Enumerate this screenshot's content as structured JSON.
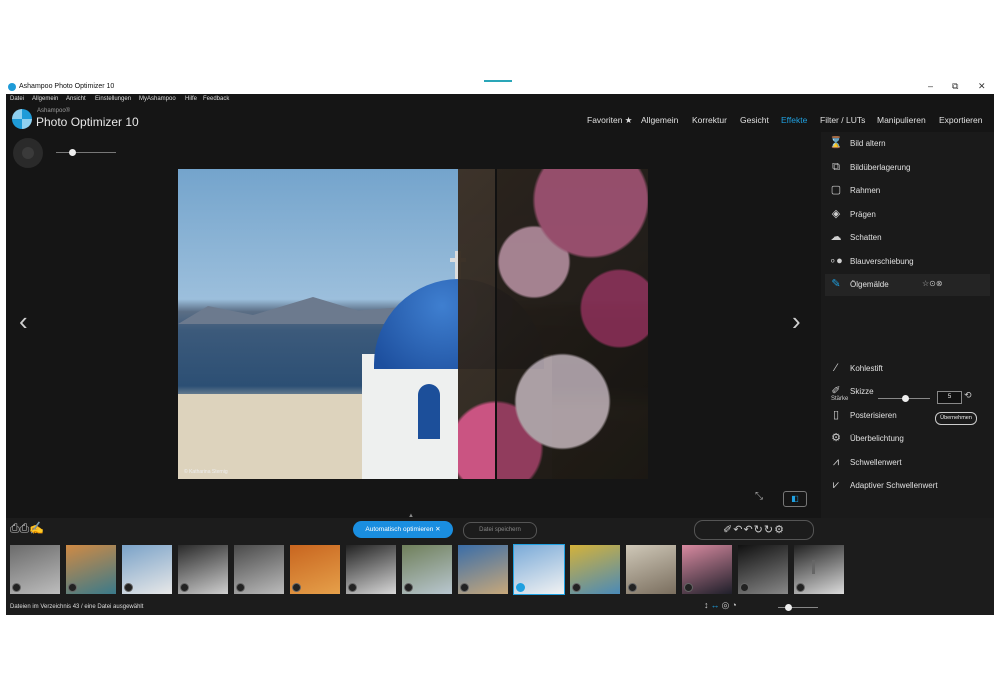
{
  "window": {
    "title": "Ashampoo Photo Optimizer 10",
    "controls": {
      "minimize": "–",
      "maximize": "⧉",
      "close": "✕"
    }
  },
  "menu": [
    "Datei",
    "Allgemein",
    "Ansicht",
    "Einstellungen",
    "MyAshampoo",
    "Hilfe",
    "Feedback"
  ],
  "brand": {
    "small": "Ashampoo®",
    "name": "Photo Optimizer 10"
  },
  "tabs": [
    {
      "label": "Favoriten ★",
      "active": false
    },
    {
      "label": "Allgemein",
      "active": false
    },
    {
      "label": "Korrektur",
      "active": false
    },
    {
      "label": "Gesicht",
      "active": false
    },
    {
      "label": "Effekte",
      "active": true
    },
    {
      "label": "Filter / LUTs",
      "active": false
    },
    {
      "label": "Manipulieren",
      "active": false
    },
    {
      "label": "Exportieren",
      "active": false
    }
  ],
  "photo": {
    "credit": "© Katharina Sternig"
  },
  "nav": {
    "prev": "‹",
    "next": "›"
  },
  "effects": [
    {
      "label": "Bild altern",
      "icon": "hourglass-icon",
      "glyph": "⌛"
    },
    {
      "label": "Bildüberlagerung",
      "icon": "layers-icon",
      "glyph": "⧉"
    },
    {
      "label": "Rahmen",
      "icon": "frame-icon",
      "glyph": "▢"
    },
    {
      "label": "Prägen",
      "icon": "emboss-icon",
      "glyph": "◈"
    },
    {
      "label": "Schatten",
      "icon": "shadow-icon",
      "glyph": "☁"
    },
    {
      "label": "Blauverschiebung",
      "icon": "blueshift-icon",
      "glyph": "∘●"
    },
    {
      "label": "Ölgemälde",
      "icon": "brush-icon",
      "glyph": "✎",
      "selected": true,
      "tools": "☆⊙⊗"
    },
    {
      "label": "Kohlestift",
      "icon": "charcoal-icon",
      "glyph": "⁄"
    },
    {
      "label": "Skizze",
      "icon": "pencil-icon",
      "glyph": "✐"
    },
    {
      "label": "Posterisieren",
      "icon": "poster-icon",
      "glyph": "▯"
    },
    {
      "label": "Überbelichtung",
      "icon": "overexpose-icon",
      "glyph": "⚙"
    },
    {
      "label": "Schwellenwert",
      "icon": "threshold-icon",
      "glyph": "⩘"
    },
    {
      "label": "Adaptiver Schwellenwert",
      "icon": "adaptive-threshold-icon",
      "glyph": "⩗"
    }
  ],
  "strength": {
    "label": "Stärke",
    "value": "5",
    "apply": "Übernehmen",
    "level": 0.5
  },
  "compare_glyph": "◧",
  "shrink_glyph": "⤡",
  "bottom": {
    "icons": "⎙⎙✍",
    "auto_optimize": "Automatisch optimieren  ✕",
    "save": "Datei speichern",
    "tools": "✐↶↶↻↻⚙"
  },
  "thumbnails": [
    {
      "name": "route-66",
      "colors": [
        "#6b6b6b",
        "#bdbdbd"
      ]
    },
    {
      "name": "horseshoe-bend",
      "colors": [
        "#d08a44",
        "#3a7a8a"
      ]
    },
    {
      "name": "waterfall-town",
      "colors": [
        "#7aa2c8",
        "#e8e8e8"
      ]
    },
    {
      "name": "flowers-bw",
      "colors": [
        "#2a2a2a",
        "#cfcfcf"
      ]
    },
    {
      "name": "rocks-bw",
      "colors": [
        "#4a4a4a",
        "#bcbcbc"
      ]
    },
    {
      "name": "monument-valley",
      "colors": [
        "#c8651f",
        "#e6a04a"
      ]
    },
    {
      "name": "street-carriage",
      "colors": [
        "#222",
        "#d8d8d8"
      ]
    },
    {
      "name": "river-road",
      "colors": [
        "#6f7f5a",
        "#b9c7d0"
      ]
    },
    {
      "name": "harbor-town",
      "colors": [
        "#3a6da8",
        "#c8a87a"
      ]
    },
    {
      "name": "santorini",
      "colors": [
        "#7aaad8",
        "#f2f2f2"
      ],
      "selected": true
    },
    {
      "name": "old-truck",
      "colors": [
        "#d4b23a",
        "#4a8ab8"
      ]
    },
    {
      "name": "building-facade",
      "colors": [
        "#cfc8b8",
        "#7a6e5e"
      ]
    },
    {
      "name": "palm-sunset",
      "colors": [
        "#d88aa0",
        "#1f1f2a"
      ]
    },
    {
      "name": "dark-portrait",
      "colors": [
        "#111",
        "#888"
      ]
    },
    {
      "name": "bw-arch",
      "colors": [
        "#222",
        "#dcdcdc"
      ]
    }
  ],
  "status": "Dateien im Verzeichnis 43 / eine Datei ausgewählt",
  "status_icons": {
    "a": "↕",
    "b": "↔",
    "c": "◎◔"
  }
}
